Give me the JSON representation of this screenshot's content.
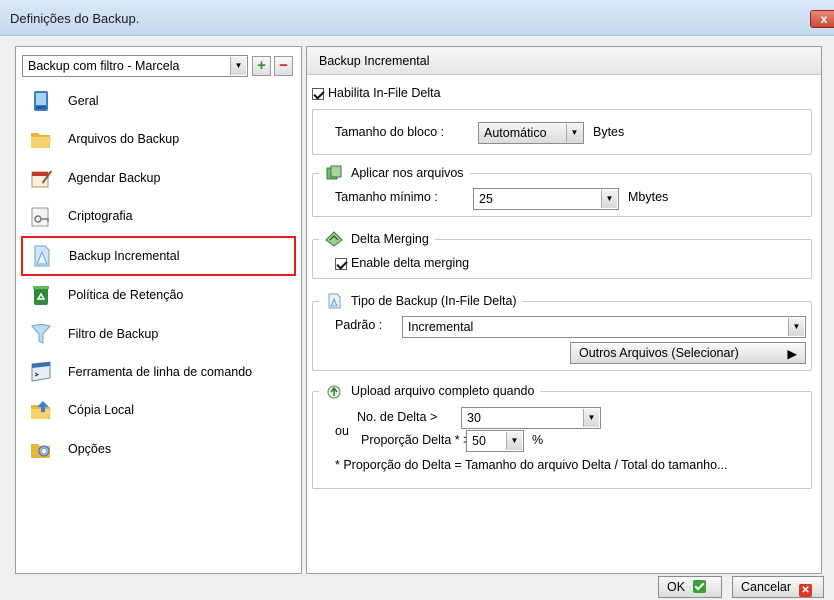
{
  "window": {
    "title": "Definições do Backup.",
    "close_label": "x"
  },
  "sidebar": {
    "profile": "Backup com filtro - Marcela",
    "add_label": "+",
    "remove_label": "−",
    "items": [
      {
        "label": "Geral",
        "icon": "general-icon"
      },
      {
        "label": "Arquivos do Backup",
        "icon": "folder-icon"
      },
      {
        "label": "Agendar Backup",
        "icon": "calendar-icon"
      },
      {
        "label": "Criptografia",
        "icon": "key-icon"
      },
      {
        "label": "Backup Incremental",
        "icon": "incremental-icon",
        "selected": true
      },
      {
        "label": "Política de Retenção",
        "icon": "recycle-bin-icon"
      },
      {
        "label": "Filtro de Backup",
        "icon": "filter-icon"
      },
      {
        "label": "Ferramenta de linha de comando",
        "icon": "command-line-icon"
      },
      {
        "label": "Cópia Local",
        "icon": "local-copy-icon"
      },
      {
        "label": "Opções",
        "icon": "options-icon"
      }
    ]
  },
  "main": {
    "header": "Backup Incremental",
    "enable_infile_delta": "Habilita In-File Delta",
    "block_size_label": "Tamanho do bloco :",
    "block_size_value": "Automático",
    "block_size_unit": "Bytes",
    "apply_files": {
      "title": "Aplicar nos arquivos",
      "min_size_label": "Tamanho mínimo :",
      "min_size_value": "25",
      "min_size_unit": "Mbytes"
    },
    "delta_merging": {
      "title": "Delta Merging",
      "checkbox_label": "Enable delta merging"
    },
    "backup_type": {
      "title": "Tipo de Backup (In-File Delta)",
      "default_label": "Padrão :",
      "default_value": "Incremental",
      "other_files_button": "Outros Arquivos (Selecionar)"
    },
    "upload_full": {
      "title": "Upload arquivo completo quando",
      "or_label": "ou",
      "delta_count_label": "No. de Delta >",
      "delta_count_value": "30",
      "delta_ratio_label": "Proporção Delta * >",
      "delta_ratio_value": "50",
      "delta_ratio_unit": "%",
      "footnote": "* Proporção do Delta  = Tamanho do arquivo Delta / Total do tamanho..."
    }
  },
  "footer": {
    "ok_label": "OK",
    "cancel_label": "Cancelar"
  }
}
